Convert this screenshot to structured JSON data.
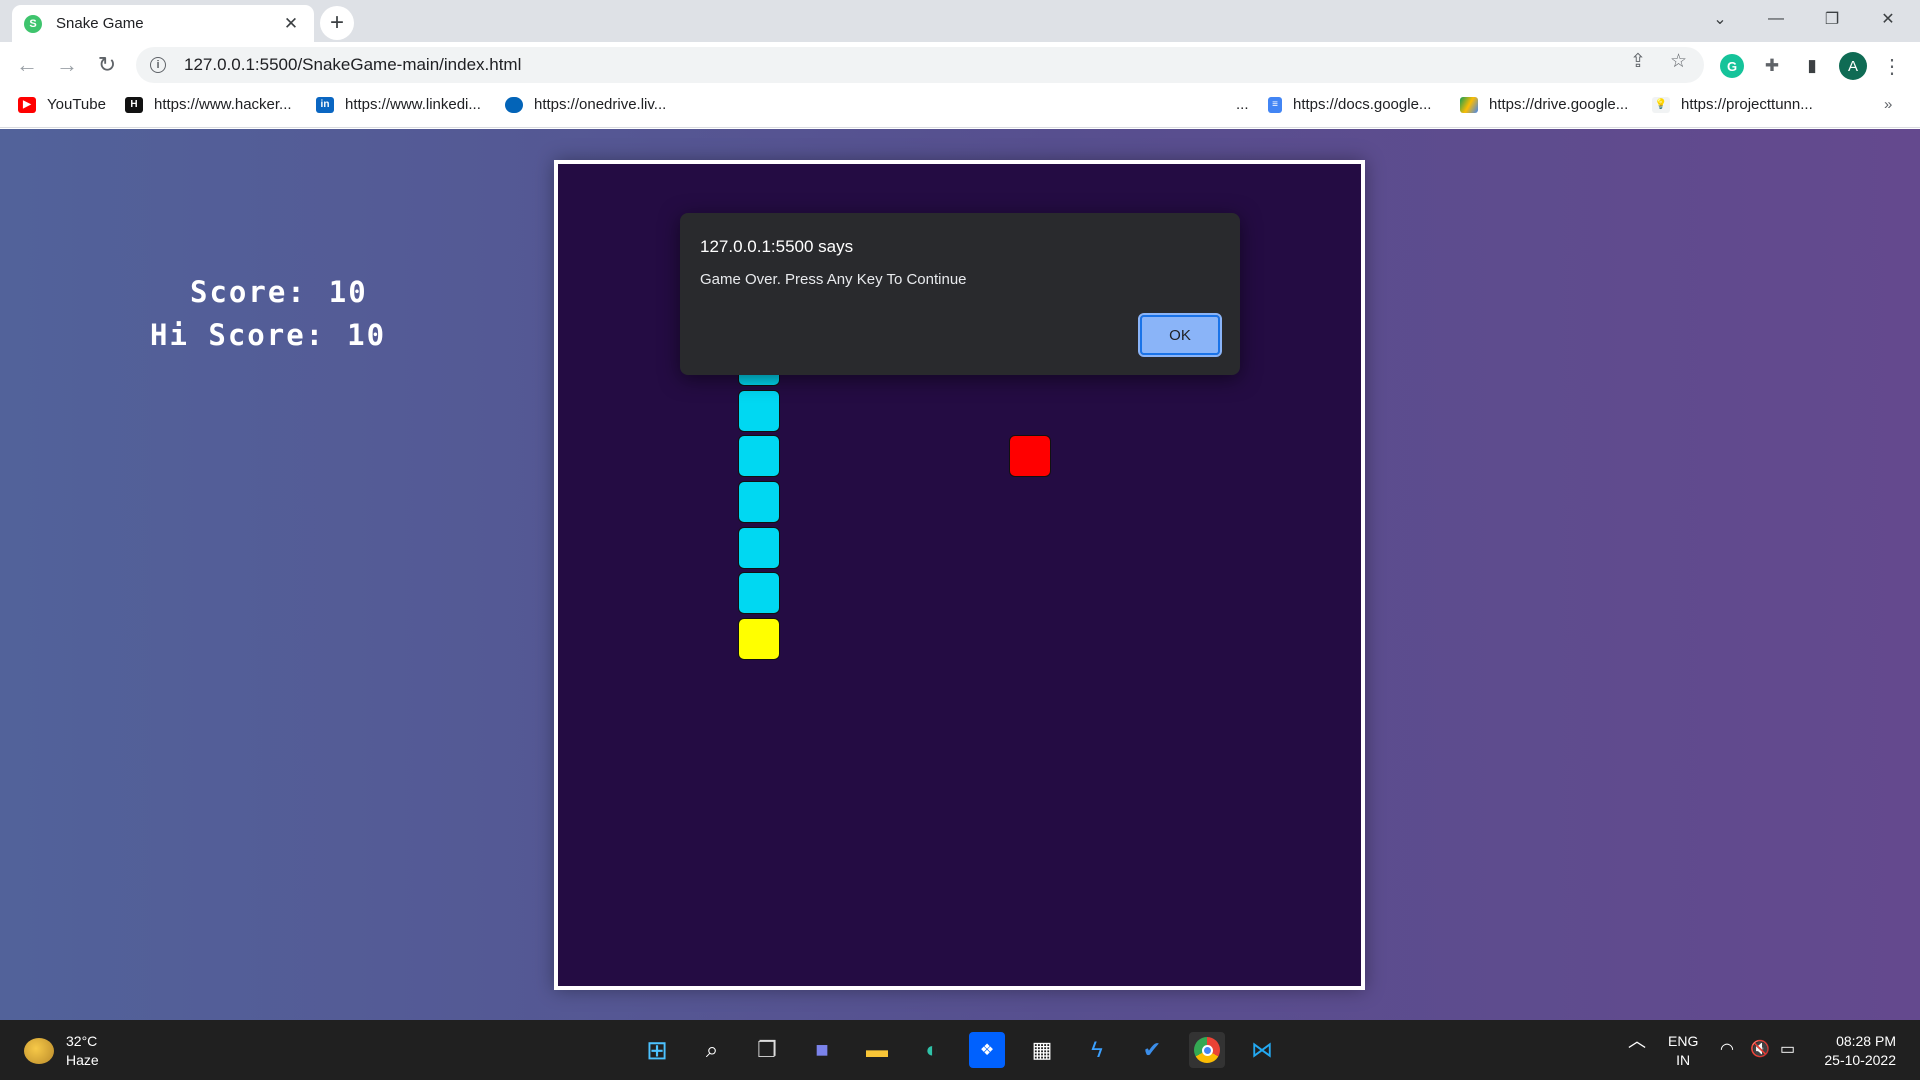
{
  "browser": {
    "tab_title": "Snake Game",
    "url": "127.0.0.1:5500/SnakeGame-main/index.html",
    "avatar_initial": "A",
    "bookmarks": [
      {
        "label": "YouTube",
        "icon": "youtube-icon"
      },
      {
        "label": "https://www.hacker...",
        "icon": "hackerrank-icon"
      },
      {
        "label": "https://www.linkedi...",
        "icon": "linkedin-icon"
      },
      {
        "label": "https://onedrive.liv...",
        "icon": "onedrive-icon"
      },
      {
        "label": "...",
        "icon": ""
      },
      {
        "label": "https://docs.google...",
        "icon": "google-docs-icon"
      },
      {
        "label": "https://drive.google...",
        "icon": "google-drive-icon"
      },
      {
        "label": "https://projecttunn...",
        "icon": "bulb-icon"
      }
    ],
    "more_bookmarks": "»"
  },
  "game": {
    "score_label": "Score:",
    "score_value": "10",
    "hiscore_label": "Hi Score:",
    "hiscore_value": "10",
    "colors": {
      "board": "#240c43",
      "snake": "#00d8f2",
      "head": "#ffff00",
      "food": "#ff0000",
      "border": "#ffffff"
    }
  },
  "dialog": {
    "title": "127.0.0.1:5500 says",
    "message": "Game Over. Press Any Key To Continue",
    "ok_label": "OK"
  },
  "taskbar": {
    "temperature": "32°C",
    "weather": "Haze",
    "language": "ENG",
    "region": "IN",
    "time": "08:28 PM",
    "date": "25-10-2022"
  }
}
